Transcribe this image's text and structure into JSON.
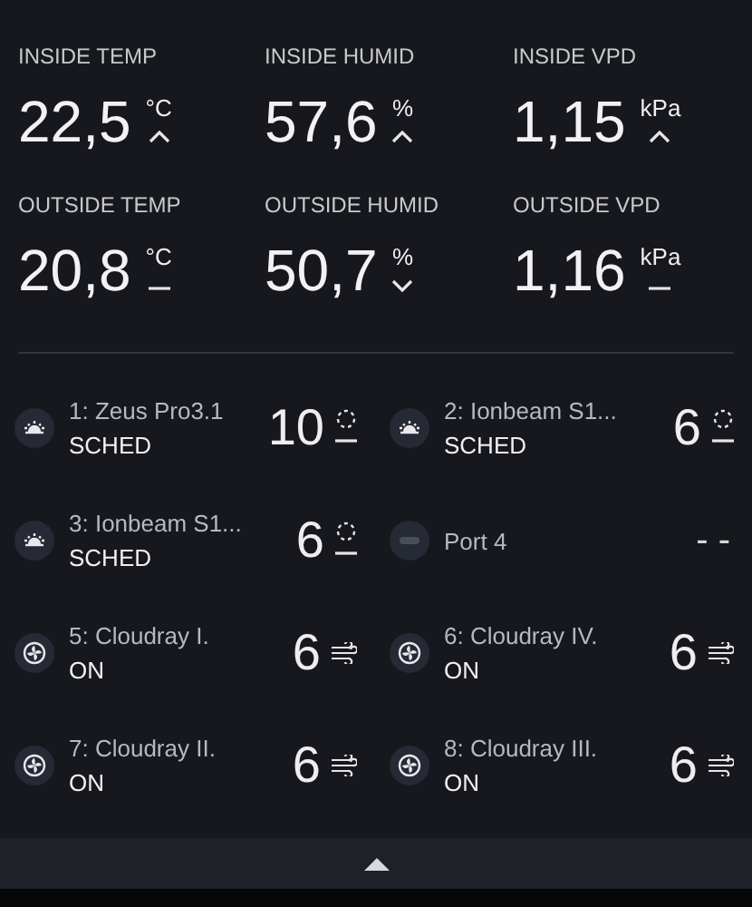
{
  "sensors": [
    {
      "label": "INSIDE TEMP",
      "value": "22,5",
      "unit": "°C",
      "kind": "up"
    },
    {
      "label": "INSIDE HUMID",
      "value": "57,6",
      "unit": "%",
      "kind": "up"
    },
    {
      "label": "INSIDE VPD",
      "value": "1,15",
      "unit": "kPa",
      "kind": "up"
    },
    {
      "label": "OUTSIDE TEMP",
      "value": "20,8",
      "unit": "°C",
      "kind": "steady"
    },
    {
      "label": "OUTSIDE HUMID",
      "value": "50,7",
      "unit": "%",
      "kind": "down"
    },
    {
      "label": "OUTSIDE VPD",
      "value": "1,16",
      "unit": "kPa",
      "kind": "steady"
    }
  ],
  "ports": [
    {
      "kind": "light",
      "name": "1: Zeus Pro3.1",
      "mode": "SCHED",
      "value": "10"
    },
    {
      "kind": "light",
      "name": "2: Ionbeam S1...",
      "mode": "SCHED",
      "value": "6"
    },
    {
      "kind": "light",
      "name": "3: Ionbeam S1...",
      "mode": "SCHED",
      "value": "6"
    },
    {
      "kind": "empty",
      "name": "Port 4",
      "value": "- -"
    },
    {
      "kind": "fan",
      "name": "5: Cloudray I.",
      "mode": "ON",
      "value": "6"
    },
    {
      "kind": "fan",
      "name": "6: Cloudray IV.",
      "mode": "ON",
      "value": "6"
    },
    {
      "kind": "fan",
      "name": "7: Cloudray II.",
      "mode": "ON",
      "value": "6"
    },
    {
      "kind": "fan",
      "name": "8: Cloudray III.",
      "mode": "ON",
      "value": "6"
    }
  ]
}
